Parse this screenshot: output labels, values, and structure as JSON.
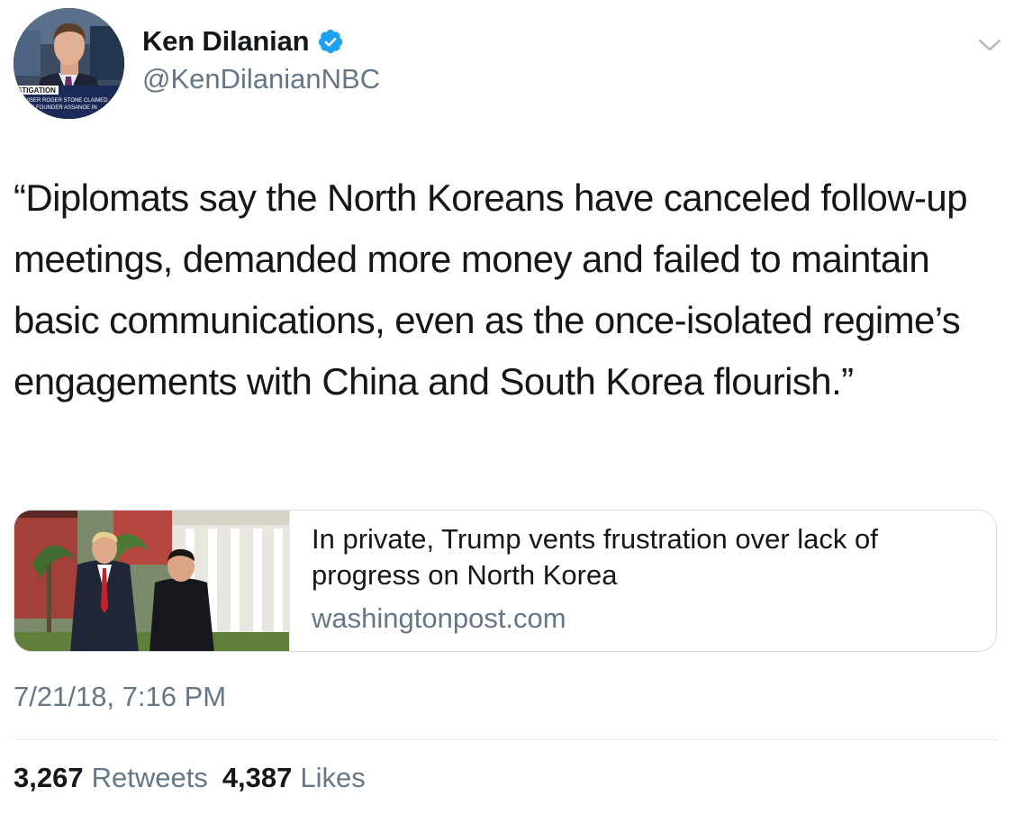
{
  "author": {
    "display_name": "Ken Dilanian",
    "handle": "@KenDilanianNBC",
    "verified": true,
    "avatar_overlay_lines": [
      "STIGATION",
      "ADVISER ROGER STONE CLAIMED",
      "LEAKS FOUNDER ASSANGE IN"
    ]
  },
  "tweet": {
    "text": "“Diplomats say the North Koreans have canceled follow-up meetings, demanded more money and failed to maintain basic communications, even as the once-isolated regime’s engagements with China and South Korea flourish.”",
    "timestamp": "7/21/18, 7:16 PM"
  },
  "card": {
    "title": "In private, Trump vents frustration over lack of progress on North Korea",
    "domain": "washingtonpost.com"
  },
  "stats": {
    "retweets_count": "3,267",
    "retweets_label": "Retweets",
    "likes_count": "4,387",
    "likes_label": "Likes"
  },
  "icons": {
    "verified": "verified-badge-icon",
    "menu": "chevron-down-icon"
  },
  "colors": {
    "text_primary": "#14171a",
    "text_secondary": "#657786",
    "verified_blue": "#1da1f2",
    "border": "#e1e8ed"
  }
}
